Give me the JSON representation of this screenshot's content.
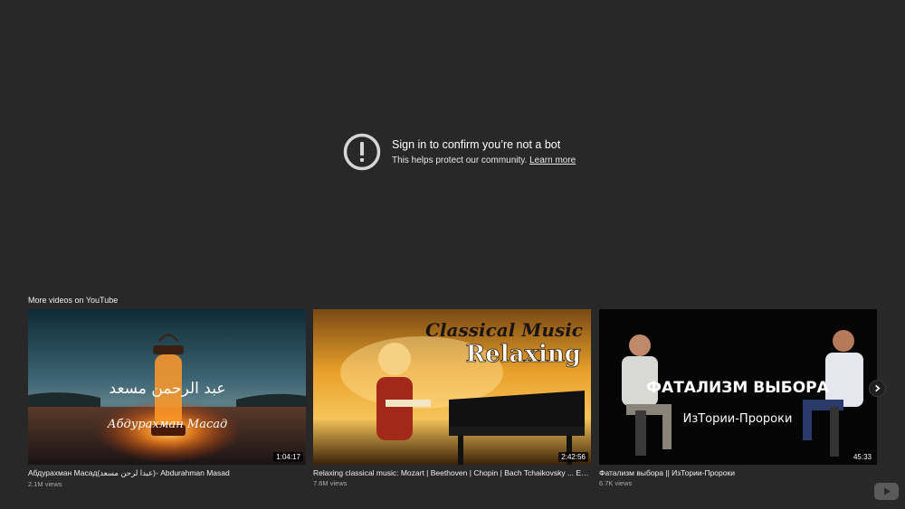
{
  "notice": {
    "title": "Sign in to confirm you’re not a bot",
    "subtitle": "This helps protect our community.",
    "learn_more": "Learn more",
    "icon": "alert-circle-icon"
  },
  "more_videos": {
    "label": "More videos on YouTube",
    "videos": [
      {
        "title": "Абдурахман Масад(عبدا لرحن مسعد)- Abdurahman Masad",
        "views": "2.1M views",
        "duration": "1:04:17",
        "thumb_text_arabic": "عبد الرحمن مسعد",
        "thumb_text_cyrillic": "Абдурахман Масад"
      },
      {
        "title": "Relaxing classical music: Mozart | Beethoven | Chopin | Bach Tchaikovsky ... Episode...",
        "views": "7.6M views",
        "duration": "2:42:56",
        "thumb_text_line1": "Classical Music",
        "thumb_text_line2": "Relaxing"
      },
      {
        "title": "Фатализм выбора || ИзТории-Пророки",
        "views": "6.7K views",
        "duration": "45:33",
        "thumb_text_line1": "ФАТАЛИЗМ ВЫБОРА",
        "thumb_text_line2": "ИзТории-Пророки"
      }
    ]
  },
  "controls": {
    "next_icon": "chevron-right-icon",
    "logo_icon": "youtube-logo-icon"
  },
  "colors": {
    "background": "#282828",
    "text": "#ffffff",
    "secondary_text": "#aaaaaa"
  }
}
